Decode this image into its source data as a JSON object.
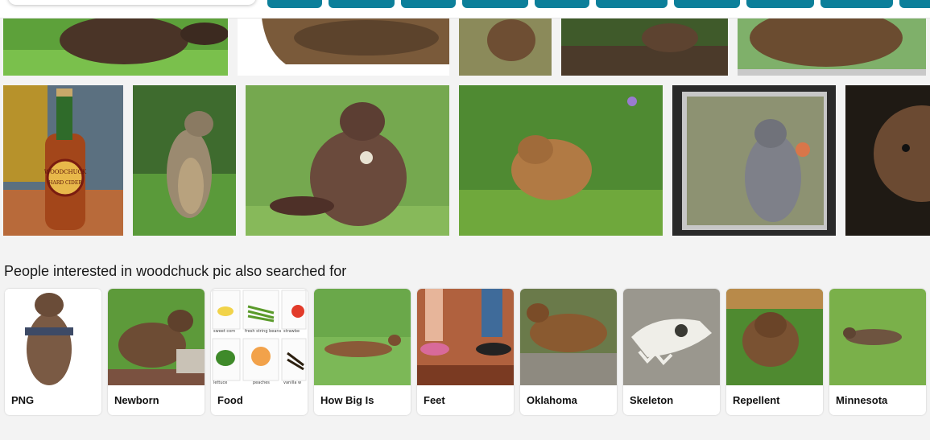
{
  "related": {
    "heading": "People interested in woodchuck pic also searched for",
    "items": [
      {
        "label": "PNG"
      },
      {
        "label": "Newborn"
      },
      {
        "label": "Food",
        "food_labels": [
          "sweet corn",
          "fresh string beans",
          "strawbe",
          "lettuce",
          "peaches",
          "vanilla w"
        ]
      },
      {
        "label": "How Big Is"
      },
      {
        "label": "Feet"
      },
      {
        "label": "Oklahoma"
      },
      {
        "label": "Skeleton"
      },
      {
        "label": "Repellent"
      },
      {
        "label": "Minnesota"
      }
    ]
  },
  "images": {
    "beer_label": "WOODCHUCK",
    "beer_sublabel": "HARD CIDER"
  },
  "colors": {
    "accent": "#0c7f9a",
    "page_bg": "#f3f3f3"
  }
}
